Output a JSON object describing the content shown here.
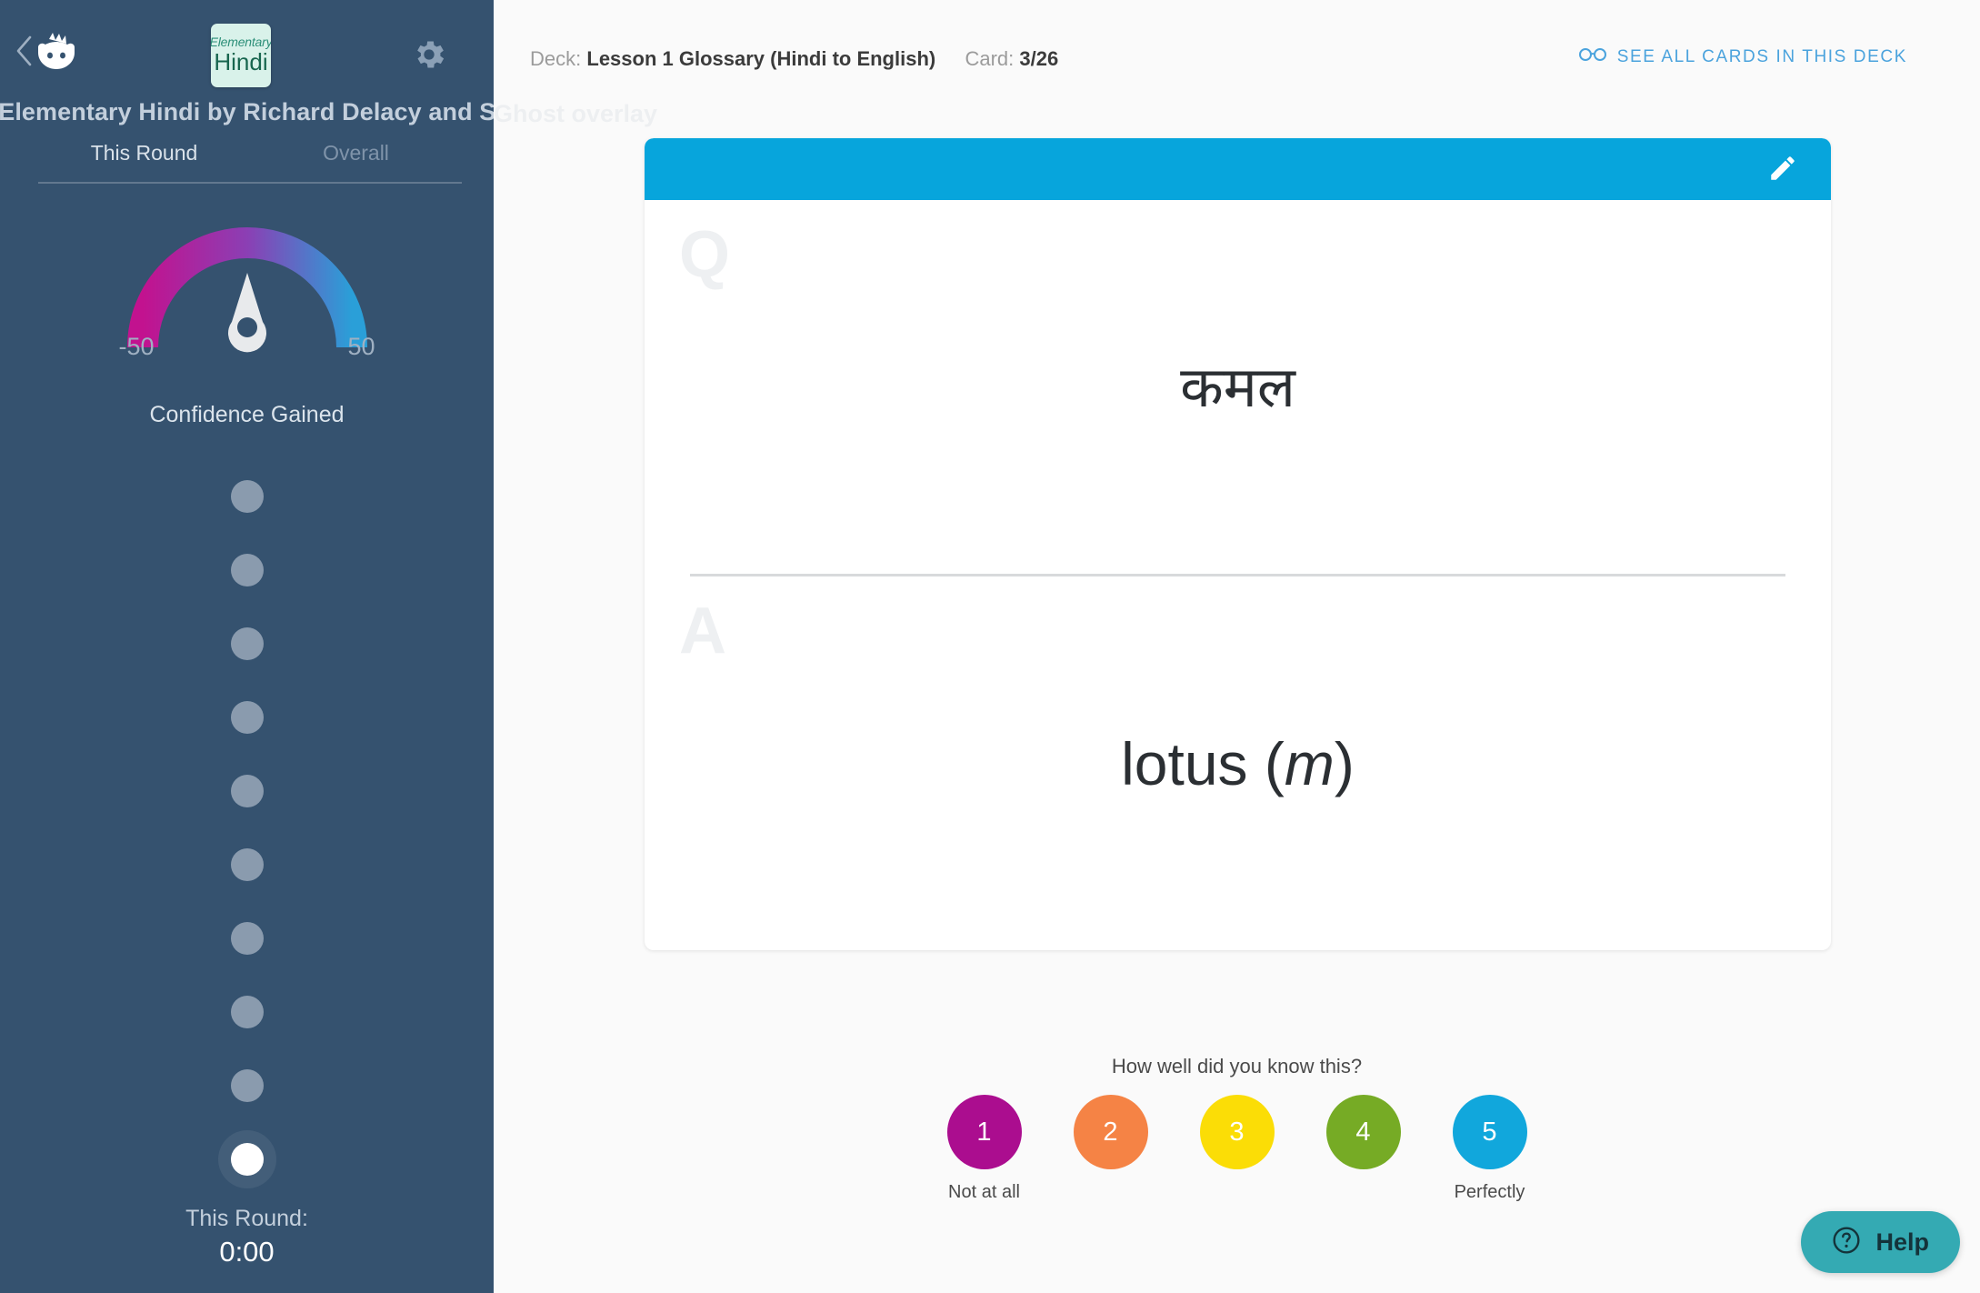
{
  "sidebar": {
    "back_icon": "back-chevron-icon",
    "mascot_icon": "brainscape-owl-logo",
    "settings_icon": "gear-icon",
    "deck_logo": {
      "line1": "Elementary",
      "line2": "Hindi"
    },
    "deck_title": "r Elementary Hindi by Richard Delacy and Sudha",
    "tabs": [
      {
        "label": "This Round",
        "active": true
      },
      {
        "label": "Overall",
        "active": false
      }
    ],
    "gauge": {
      "min_label": "-50",
      "max_label": "50",
      "caption": "Confidence Gained",
      "value": 0,
      "gradient_start": "#c2128f",
      "gradient_end": "#2a9fd8",
      "needle_color": "#e8eaec"
    },
    "progress_dots": {
      "total": 10,
      "current_index": 10,
      "inactive_color": "#8a9bae",
      "active_color": "#ffffff"
    },
    "round_timer": {
      "label": "This Round:",
      "value": "0:00"
    },
    "background_color": "#35526f"
  },
  "header": {
    "deck_prefix": "Deck:",
    "deck_name": "Lesson 1 Glossary (Hindi to English)",
    "card_prefix": "Card:",
    "card_position": "3/26",
    "see_all_label": "SEE ALL CARDS IN THIS DECK",
    "see_all_icon": "glasses-icon",
    "see_all_color": "#4ba3dd"
  },
  "ghost_text": "Ghost overlay",
  "card": {
    "header_color": "#07a5dc",
    "edit_icon": "pencil-icon",
    "question_marker": "Q",
    "question_text": "कमल",
    "answer_marker": "A",
    "answer_text_main": "lotus (",
    "answer_text_italic": "m",
    "answer_text_tail": ")"
  },
  "rating": {
    "prompt": "How well did you know this?",
    "buttons": [
      {
        "value": "1",
        "color": "#ab0d8f",
        "caption": "Not at all"
      },
      {
        "value": "2",
        "color": "#f58345",
        "caption": ""
      },
      {
        "value": "3",
        "color": "#fbdd06",
        "caption": ""
      },
      {
        "value": "4",
        "color": "#76ab25",
        "caption": ""
      },
      {
        "value": "5",
        "color": "#11a7dc",
        "caption": "Perfectly"
      }
    ]
  },
  "help": {
    "label": "Help",
    "icon": "question-circle-icon",
    "color": "#34aab3"
  }
}
